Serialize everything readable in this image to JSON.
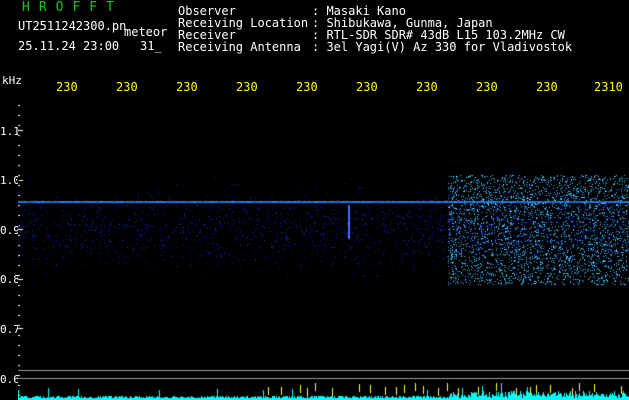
{
  "header": {
    "app_title": "HROFFT",
    "file_name": "UT2511242300.pn",
    "mode_label": "meteor",
    "datetime": "25.11.24 23:00",
    "count": "31_",
    "info": [
      {
        "label": "Observer",
        "value": ": Masaki Kano"
      },
      {
        "label": "Receiving Location",
        "value": ": Shibukawa, Gunma, Japan"
      },
      {
        "label": "Receiver",
        "value": ": RTL-SDR SDR# 43dB L15 103.2MHz CW"
      },
      {
        "label": "Receiving Antenna",
        "value": ": 3el Yagi(V) Az 330 for Vladivostok"
      }
    ]
  },
  "axis": {
    "y_unit": "kHz",
    "y_ticks": [
      "1.1",
      "1.0",
      "0.9",
      "0.8",
      "0.7",
      "0.6"
    ],
    "x_ticks": [
      "230",
      "230",
      "230",
      "230",
      "230",
      "230",
      "230",
      "230",
      "230",
      "2310"
    ]
  },
  "colors": {
    "title": "#19c21a",
    "tick_x": "#ffff00",
    "signal": "#3f4dff",
    "carrier": "#4aa8ff",
    "bars": "#00ffff"
  }
}
